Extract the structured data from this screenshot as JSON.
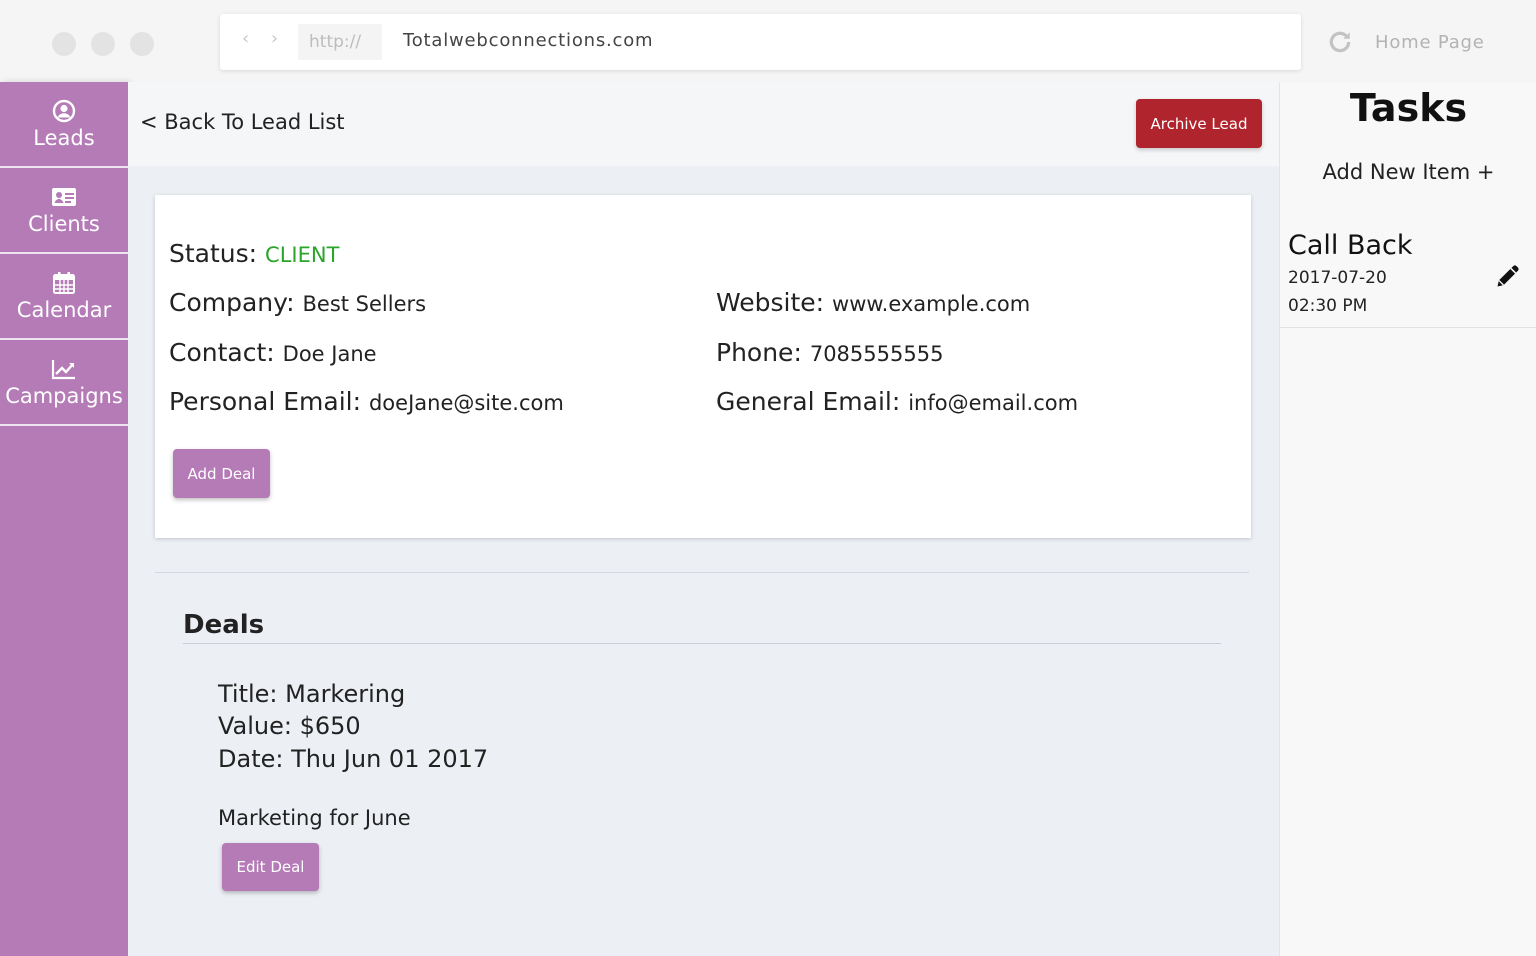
{
  "browser": {
    "protocol": "http://",
    "url": "Totalwebconnections.com",
    "home": "Home Page",
    "nav_arrows": "‹ ›"
  },
  "sidebar": {
    "items": [
      {
        "label": "Leads",
        "icon": "user-circle-icon"
      },
      {
        "label": "Clients",
        "icon": "id-card-icon"
      },
      {
        "label": "Calendar",
        "icon": "calendar-icon"
      },
      {
        "label": "Campaigns",
        "icon": "line-chart-icon"
      }
    ]
  },
  "header": {
    "back": "< Back To Lead List",
    "archive": "Archive Lead"
  },
  "lead": {
    "status_label": "Status:",
    "status": "CLIENT",
    "company_label": "Company:",
    "company": "Best Sellers",
    "website_label": "Website:",
    "website": "www.example.com",
    "contact_label": "Contact:",
    "contact": "Doe Jane",
    "phone_label": "Phone:",
    "phone": "7085555555",
    "personal_email_label": "Personal Email:",
    "personal_email": "doeJane@site.com",
    "general_email_label": "General Email:",
    "general_email": "info@email.com",
    "add_deal": "Add Deal"
  },
  "deals": {
    "title": "Deals",
    "items": [
      {
        "title": "Title: Markering",
        "value": "Value: $650",
        "date": "Date: Thu Jun 01 2017",
        "description": "Marketing for June",
        "edit": "Edit Deal"
      }
    ]
  },
  "tasks": {
    "title": "Tasks",
    "add": "Add New Item +",
    "items": [
      {
        "title": "Call Back",
        "date": "2017-07-20",
        "time": "02:30 PM"
      }
    ]
  },
  "colors": {
    "sidebar": "#b47bb6",
    "archive": "#b0242d",
    "status": "#2aa52a"
  }
}
